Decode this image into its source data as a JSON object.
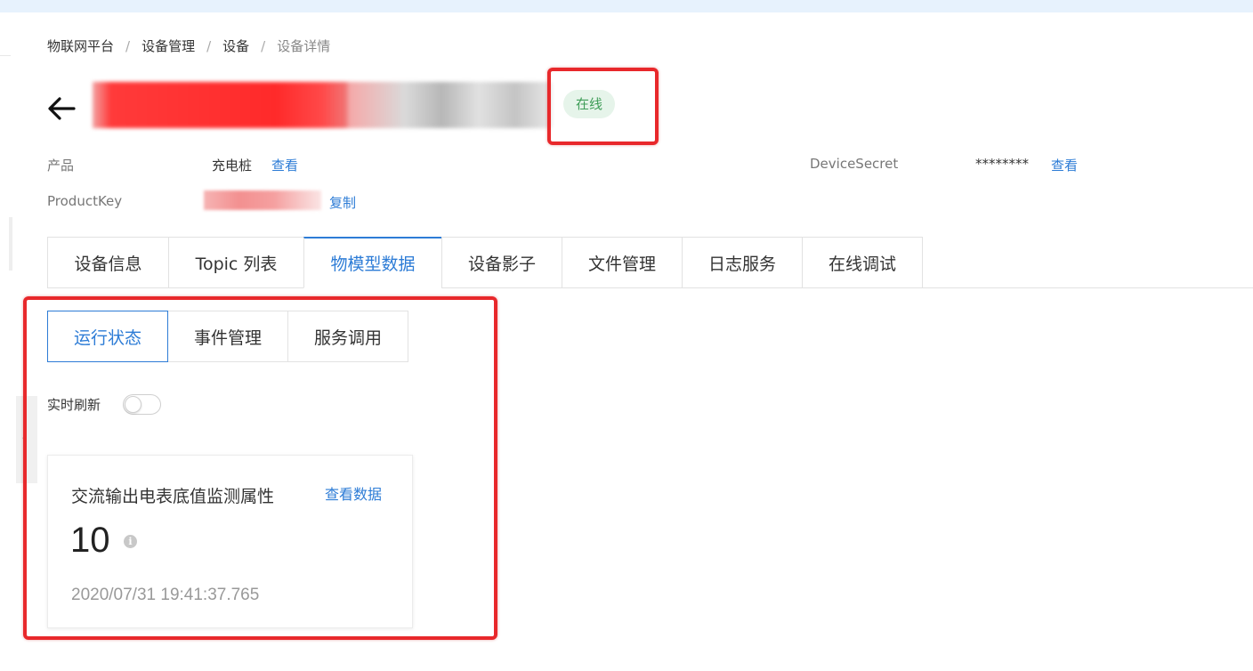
{
  "breadcrumb": {
    "items": [
      "物联网平台",
      "设备管理",
      "设备"
    ],
    "current": "设备详情",
    "separator": "/"
  },
  "device": {
    "status": "在线",
    "status_color": "#3f9d58"
  },
  "info": {
    "product_label": "产品",
    "product_value": "充电桩",
    "product_link": "查看",
    "productkey_label": "ProductKey",
    "productkey_link": "复制",
    "secret_label": "DeviceSecret",
    "secret_value": "********",
    "secret_link": "查看"
  },
  "tabs": [
    {
      "label": "设备信息"
    },
    {
      "label": "Topic 列表"
    },
    {
      "label": "物模型数据",
      "active": true
    },
    {
      "label": "设备影子"
    },
    {
      "label": "文件管理"
    },
    {
      "label": "日志服务"
    },
    {
      "label": "在线调试"
    }
  ],
  "subtabs": [
    {
      "label": "运行状态",
      "active": true
    },
    {
      "label": "事件管理"
    },
    {
      "label": "服务调用"
    }
  ],
  "refresh": {
    "label": "实时刷新",
    "enabled": false
  },
  "property_card": {
    "title": "交流输出电表底值监测属性",
    "link": "查看数据",
    "value": "10",
    "info_icon": "info-icon",
    "timestamp": "2020/07/31 19:41:37.765"
  },
  "colors": {
    "accent": "#2d7cd6",
    "highlight": "#e8282b"
  }
}
